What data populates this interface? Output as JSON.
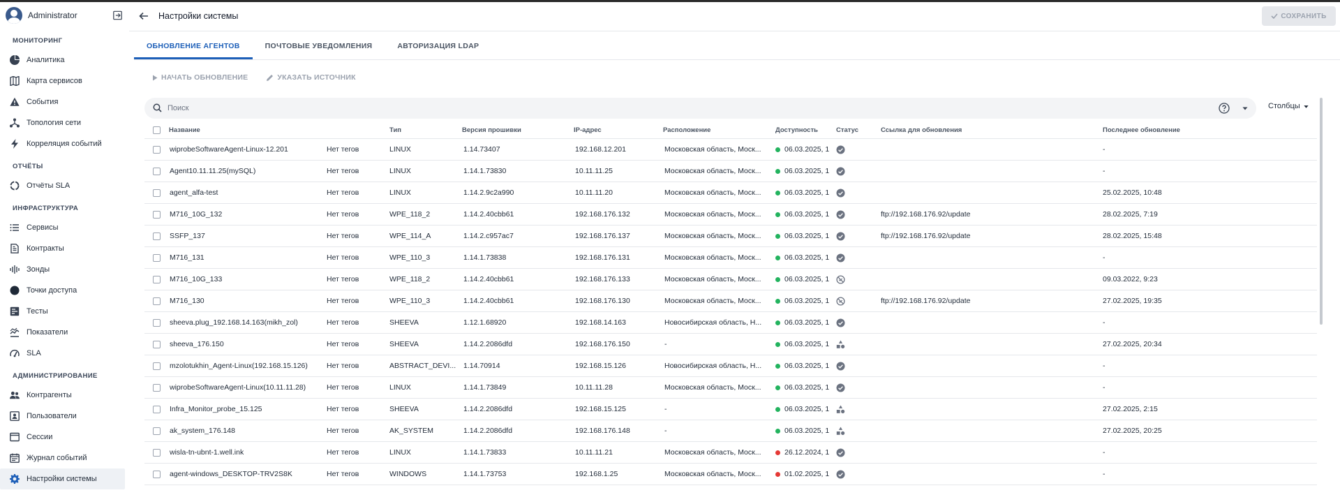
{
  "colors": {
    "accent": "#1d5fb8",
    "online": "#22b35e",
    "offline": "#e53935"
  },
  "user": {
    "name": "Administrator"
  },
  "sidebar": {
    "sections": [
      {
        "title": "МОНИТОРИНГ",
        "items": [
          {
            "label": "Аналитика",
            "icon": "pie-chart-icon"
          },
          {
            "label": "Карта сервисов",
            "icon": "map-icon"
          },
          {
            "label": "События",
            "icon": "warning-icon"
          },
          {
            "label": "Топология сети",
            "icon": "topology-icon"
          },
          {
            "label": "Корреляция событий",
            "icon": "lightning-icon"
          }
        ]
      },
      {
        "title": "ОТЧЁТЫ",
        "items": [
          {
            "label": "Отчёты SLA",
            "icon": "circle-progress-icon"
          }
        ]
      },
      {
        "title": "ИНФРАСТРУКТУРА",
        "items": [
          {
            "label": "Сервисы",
            "icon": "list-icon"
          },
          {
            "label": "Контракты",
            "icon": "document-icon"
          },
          {
            "label": "Зонды",
            "icon": "signal-icon"
          },
          {
            "label": "Точки доступа",
            "icon": "dot-icon"
          },
          {
            "label": "Тесты",
            "icon": "test-icon"
          },
          {
            "label": "Показатели",
            "icon": "metrics-icon"
          },
          {
            "label": "SLA",
            "icon": "gauge-icon"
          }
        ]
      },
      {
        "title": "АДМИНИСТРИРОВАНИЕ",
        "items": [
          {
            "label": "Контрагенты",
            "icon": "people-icon"
          },
          {
            "label": "Пользователи",
            "icon": "user-card-icon"
          },
          {
            "label": "Сессии",
            "icon": "window-icon"
          },
          {
            "label": "Журнал событий",
            "icon": "calendar-icon"
          },
          {
            "label": "Настройки системы",
            "icon": "gear-icon",
            "active": true
          }
        ]
      }
    ]
  },
  "header": {
    "title": "Настройки системы",
    "save_label": "СОХРАНИТЬ"
  },
  "tabs": [
    {
      "label": "ОБНОВЛЕНИЕ АГЕНТОВ",
      "active": true
    },
    {
      "label": "ПОЧТОВЫЕ УВЕДОМЛЕНИЯ"
    },
    {
      "label": "АВТОРИЗАЦИЯ LDAP"
    }
  ],
  "actions": {
    "start_update": "НАЧАТЬ ОБНОВЛЕНИЕ",
    "set_source": "УКАЗАТЬ ИСТОЧНИК"
  },
  "search": {
    "placeholder": "Поиск",
    "value": ""
  },
  "columns_label": "Столбцы",
  "table": {
    "headers": [
      "Название",
      "Тип",
      "Версия прошивки",
      "IP-адрес",
      "Расположение",
      "Доступность",
      "Статус",
      "Ссылка для обновления",
      "Последнее обновление"
    ],
    "rows": [
      {
        "name": "wiprobeSoftwareAgent-Linux-12.201",
        "tags": "Нет тегов",
        "type": "LINUX",
        "fw": "1.14.73407",
        "ip": "192.168.12.201",
        "loc": "Московская область, Моск...",
        "avail": "06.03.2025, 1",
        "avail_color": "green",
        "status": "check",
        "link": "",
        "updated": "-"
      },
      {
        "name": "Agent10.11.11.25(mySQL)",
        "tags": "Нет тегов",
        "type": "LINUX",
        "fw": "1.14.1.73830",
        "ip": "10.11.11.25",
        "loc": "Московская область, Моск...",
        "avail": "06.03.2025, 1",
        "avail_color": "green",
        "status": "check",
        "link": "",
        "updated": "-"
      },
      {
        "name": "agent_alfa-test",
        "tags": "Нет тегов",
        "type": "LINUX",
        "fw": "1.14.2.9c2a990",
        "ip": "10.11.11.20",
        "loc": "Московская область, Моск...",
        "avail": "06.03.2025, 1",
        "avail_color": "green",
        "status": "check",
        "link": "",
        "updated": "25.02.2025, 10:48"
      },
      {
        "name": "M716_10G_132",
        "tags": "Нет тегов",
        "type": "WPE_118_2",
        "fw": "1.14.2.40cbb61",
        "ip": "192.168.176.132",
        "loc": "Московская область, Моск...",
        "avail": "06.03.2025, 1",
        "avail_color": "green",
        "status": "check",
        "link": "ftp://192.168.176.92/update",
        "updated": "28.02.2025, 7:19"
      },
      {
        "name": "SSFP_137",
        "tags": "Нет тегов",
        "type": "WPE_114_A",
        "fw": "1.14.2.c957ac7",
        "ip": "192.168.176.137",
        "loc": "Московская область, Моск...",
        "avail": "06.03.2025, 1",
        "avail_color": "green",
        "status": "check",
        "link": "ftp://192.168.176.92/update",
        "updated": "28.02.2025, 15:48"
      },
      {
        "name": "M716_131",
        "tags": "Нет тегов",
        "type": "WPE_110_3",
        "fw": "1.14.1.73838",
        "ip": "192.168.176.131",
        "loc": "Московская область, Моск...",
        "avail": "06.03.2025, 1",
        "avail_color": "green",
        "status": "check",
        "link": "",
        "updated": "-"
      },
      {
        "name": "M716_10G_133",
        "tags": "Нет тегов",
        "type": "WPE_118_2",
        "fw": "1.14.2.40cbb61",
        "ip": "192.168.176.133",
        "loc": "Московская область, Моск...",
        "avail": "06.03.2025, 1",
        "avail_color": "green",
        "status": "blocked",
        "link": "",
        "updated": "09.03.2022, 9:23"
      },
      {
        "name": "M716_130",
        "tags": "Нет тегов",
        "type": "WPE_110_3",
        "fw": "1.14.2.40cbb61",
        "ip": "192.168.176.130",
        "loc": "Московская область, Моск...",
        "avail": "06.03.2025, 1",
        "avail_color": "green",
        "status": "blocked",
        "link": "ftp://192.168.176.92/update",
        "updated": "27.02.2025, 19:35"
      },
      {
        "name": "sheeva.plug_192.168.14.163(mikh_zol)",
        "tags": "Нет тегов",
        "type": "SHEEVA",
        "fw": "1.12.1.68920",
        "ip": "192.168.14.163",
        "loc": "Новосибирская область, Н...",
        "avail": "06.03.2025, 1",
        "avail_color": "green",
        "status": "check",
        "link": "",
        "updated": "-"
      },
      {
        "name": "sheeva_176.150",
        "tags": "Нет тегов",
        "type": "SHEEVA",
        "fw": "1.14.2.2086dfd",
        "ip": "192.168.176.150",
        "loc": "-",
        "avail": "06.03.2025, 1",
        "avail_color": "green",
        "status": "shapes",
        "link": "",
        "updated": "27.02.2025, 20:34"
      },
      {
        "name": "mzolotukhin_Agent-Linux(192.168.15.126)",
        "tags": "Нет тегов",
        "type": "ABSTRACT_DEVI...",
        "fw": "1.14.70914",
        "ip": "192.168.15.126",
        "loc": "Новосибирская область, Н...",
        "avail": "06.03.2025, 1",
        "avail_color": "green",
        "status": "check",
        "link": "",
        "updated": "-"
      },
      {
        "name": "wiprobeSoftwareAgent-Linux(10.11.11.28)",
        "tags": "Нет тегов",
        "type": "LINUX",
        "fw": "1.14.1.73849",
        "ip": "10.11.11.28",
        "loc": "Московская область, Моск...",
        "avail": "06.03.2025, 1",
        "avail_color": "green",
        "status": "check",
        "link": "",
        "updated": "-"
      },
      {
        "name": "Infra_Monitor_probe_15.125",
        "tags": "Нет тегов",
        "type": "SHEEVA",
        "fw": "1.14.2.2086dfd",
        "ip": "192.168.15.125",
        "loc": "-",
        "avail": "06.03.2025, 1",
        "avail_color": "green",
        "status": "shapes",
        "link": "",
        "updated": "27.02.2025, 2:15"
      },
      {
        "name": "ak_system_176.148",
        "tags": "Нет тегов",
        "type": "AK_SYSTEM",
        "fw": "1.14.2.2086dfd",
        "ip": "192.168.176.148",
        "loc": "-",
        "avail": "06.03.2025, 1",
        "avail_color": "green",
        "status": "shapes",
        "link": "",
        "updated": "27.02.2025, 20:25"
      },
      {
        "name": "wisla-tn-ubnt-1.well.ink",
        "tags": "Нет тегов",
        "type": "LINUX",
        "fw": "1.14.1.73833",
        "ip": "10.11.11.21",
        "loc": "Московская область, Моск...",
        "avail": "26.12.2024, 1",
        "avail_color": "red",
        "status": "check",
        "link": "",
        "updated": "-"
      },
      {
        "name": "agent-windows_DESKTOP-TRV2S8K",
        "tags": "Нет тегов",
        "type": "WINDOWS",
        "fw": "1.14.1.73753",
        "ip": "192.168.1.25",
        "loc": "Московская область, Моск...",
        "avail": "01.02.2025, 1",
        "avail_color": "red",
        "status": "check",
        "link": "",
        "updated": "-"
      }
    ]
  }
}
